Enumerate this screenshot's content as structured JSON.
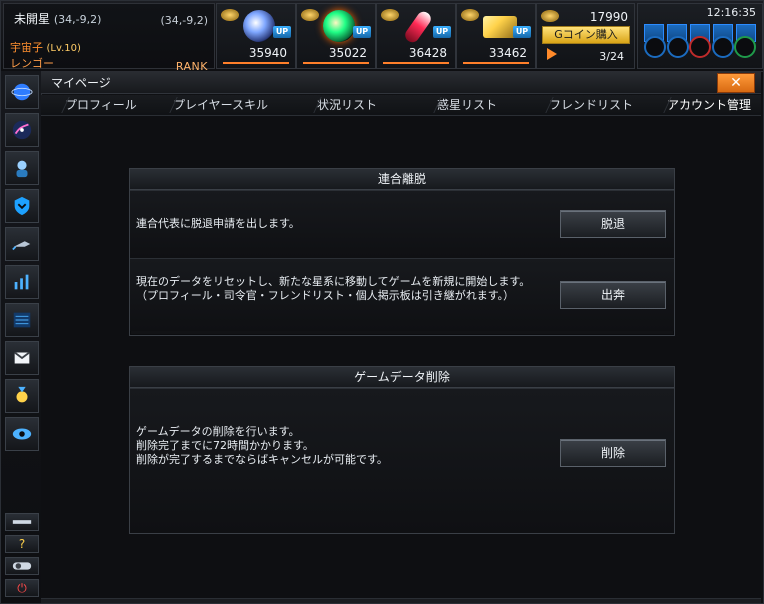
{
  "header": {
    "planet_name": "未開星",
    "planet_coords_inline": "(34,-9,2)",
    "planet_coords_right": "(34,-9,2)",
    "user_name": "宇宙子",
    "user_level": "(Lv.10)",
    "user_subtitle": "レンゴー",
    "rank_label": "RANK"
  },
  "resources": [
    {
      "name": "metal",
      "value": "35940",
      "up_label": "UP",
      "colors": {
        "core": "#7fa7ff",
        "glow": "#a6c8ff"
      }
    },
    {
      "name": "energy",
      "value": "35022",
      "up_label": "UP",
      "colors": {
        "core": "#20ff86",
        "glow": "#ffdf5c"
      }
    },
    {
      "name": "fuel",
      "value": "36428",
      "up_label": "UP",
      "colors": {
        "core": "#ff2a55",
        "glow": "#ff9aaa"
      }
    },
    {
      "name": "gold",
      "value": "33462",
      "up_label": "UP",
      "colors": {
        "core": "#ffd24a",
        "glow": "#ffec9a"
      }
    }
  ],
  "coins": {
    "count": "17990",
    "buy_label": "Gコイン購入",
    "ratio": "3/24"
  },
  "clock": {
    "time": "12:16:35"
  },
  "window": {
    "title": "マイページ",
    "close_symbol": "✕"
  },
  "tabs": [
    {
      "label": "プロフィール"
    },
    {
      "label": "プレイヤースキル"
    },
    {
      "label": "状況リスト"
    },
    {
      "label": "惑星リスト"
    },
    {
      "label": "フレンドリスト"
    },
    {
      "label": "アカウント管理",
      "active": true
    }
  ],
  "panels": [
    {
      "title": "連合離脱",
      "rows": [
        {
          "text_lines": [
            "連合代表に脱退申請を出します。"
          ],
          "button": "脱退"
        },
        {
          "text_lines": [
            "現在のデータをリセットし、新たな星系に移動してゲームを新規に開始します。",
            "（プロフィール・司令官・フレンドリスト・個人掲示板は引き継がれます。）"
          ],
          "button": "出奔"
        }
      ]
    },
    {
      "title": "ゲームデータ削除",
      "rows": [
        {
          "text_lines": [
            "ゲームデータの削除を行います。",
            "削除完了までに72時間かかります。",
            "削除が完了するまでならばキャンセルが可能です。"
          ],
          "button": "削除"
        }
      ]
    }
  ],
  "left_nav": [
    {
      "icon": "planet-icon"
    },
    {
      "icon": "galaxy-icon"
    },
    {
      "icon": "commander-icon"
    },
    {
      "icon": "shield-icon"
    },
    {
      "icon": "ship-icon"
    },
    {
      "icon": "chart-icon"
    },
    {
      "icon": "map-icon"
    },
    {
      "icon": "mail-icon"
    },
    {
      "icon": "medal-icon"
    },
    {
      "icon": "eye-icon"
    }
  ],
  "left_nav_bottom": [
    {
      "icon": "settings-icon"
    },
    {
      "icon": "help-icon",
      "label": "?"
    },
    {
      "icon": "toggle-icon"
    },
    {
      "icon": "power-icon",
      "label": "⏻"
    }
  ]
}
